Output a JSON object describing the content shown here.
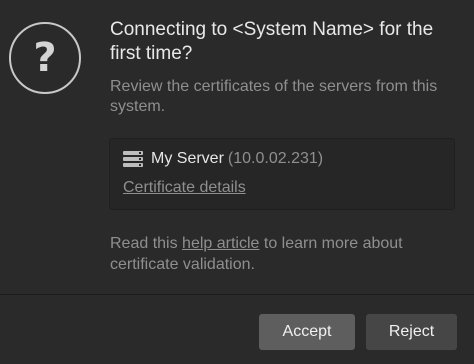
{
  "dialog": {
    "icon": "question-mark-icon",
    "icon_glyph": "?",
    "title": "Connecting to <System Name> for the first time?",
    "subtitle": "Review the certificates of the servers from this system.",
    "server": {
      "icon": "server-icon",
      "name": "My Server",
      "ip": "(10.0.02.231)",
      "cert_link": "Certificate details"
    },
    "help": {
      "prefix": "Read this ",
      "link": "help article",
      "suffix": " to learn more about certificate validation."
    },
    "buttons": {
      "accept": "Accept",
      "reject": "Reject"
    }
  }
}
